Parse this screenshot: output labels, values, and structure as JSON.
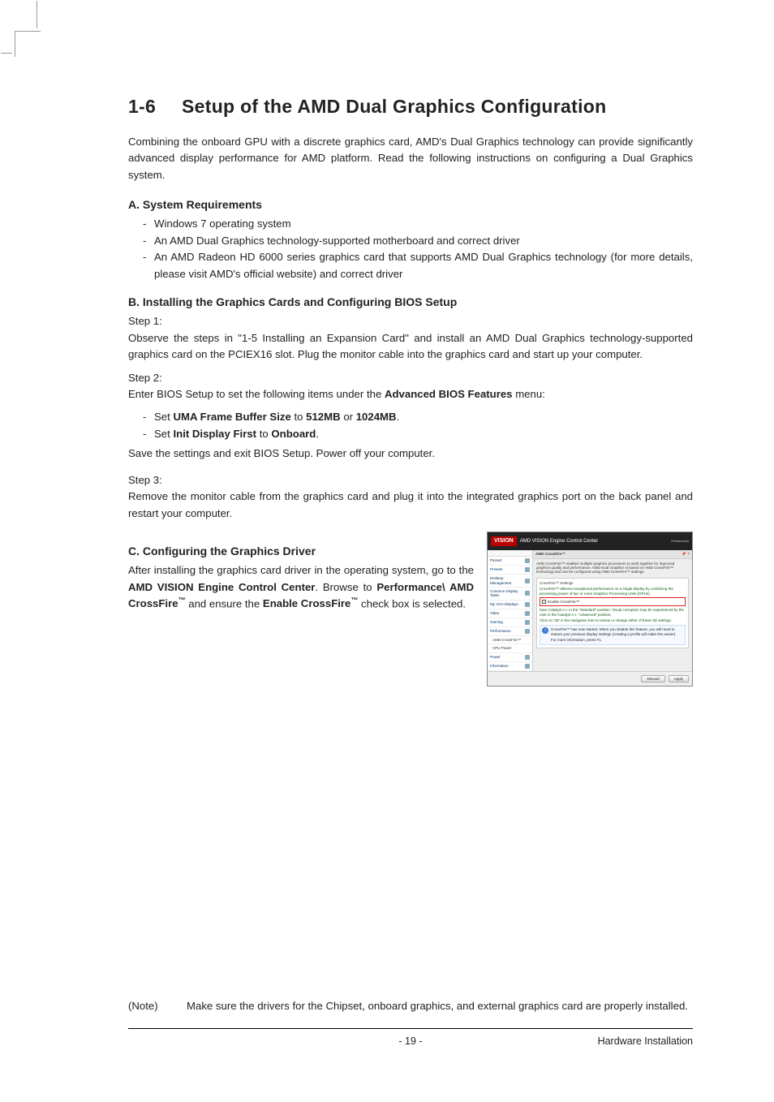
{
  "heading": {
    "number": "1-6",
    "title": "Setup of the AMD Dual Graphics Configuration"
  },
  "intro": "Combining the onboard GPU with a discrete graphics card, AMD's Dual Graphics technology can provide significantly advanced display performance for AMD platform. Read the following instructions on configuring a Dual Graphics system.",
  "sectionA": {
    "title": "A. System Requirements",
    "items": [
      "Windows 7 operating system",
      "An AMD Dual Graphics technology-supported motherboard and correct driver",
      "An AMD Radeon HD 6000 series graphics card that supports AMD Dual Graphics technology (for more details, please visit AMD's official website) and correct driver"
    ]
  },
  "sectionB": {
    "title": "B. Installing the Graphics Cards and Configuring BIOS Setup",
    "step1_label": "Step 1:",
    "step1_text": "Observe the steps in \"1-5 Installing an Expansion Card\" and install an AMD Dual Graphics technology-supported graphics card on the PCIEX16 slot. Plug the monitor cable into the graphics card and start up your computer.",
    "step2_label": "Step 2:",
    "step2_intro_pre": "Enter BIOS Setup to set the following items under the ",
    "step2_menu": "Advanced BIOS Features",
    "step2_intro_post": " menu:",
    "step2_items": {
      "a_pre": "Set ",
      "a_b1": "UMA Frame Buffer Size",
      "a_mid": " to ",
      "a_b2": "512MB",
      "a_or": " or ",
      "a_b3": "1024MB",
      "a_end": ".",
      "b_pre": "Set ",
      "b_b1": "Init Display First",
      "b_mid": " to ",
      "b_b2": "Onboard",
      "b_end": "."
    },
    "step2_save": "Save the settings and exit BIOS Setup. Power off your computer.",
    "step3_label": "Step 3:",
    "step3_text": "Remove the monitor cable from the graphics card and plug it into the integrated graphics port on the back panel and restart your computer."
  },
  "sectionC": {
    "title": "C. Configuring the Graphics Driver",
    "p_pre": "After installing the graphics card driver in the operating system, go to the ",
    "p_b1": "AMD VISION Engine Control Center",
    "p_mid1": ". Browse to ",
    "p_b2": "Performance\\ AMD CrossFire",
    "p_mid2": " and ensure the ",
    "p_b3": "Enable CrossFire",
    "p_post": " check box is selected."
  },
  "screenshot": {
    "logo": "VISION",
    "title": "AMD VISION Engine Control Center",
    "preferences": "Preferences",
    "crumb": "AMD CrossFire™",
    "pin": "📌  ?",
    "sidebar": [
      "Pinned",
      "Presets",
      "Desktop Management",
      "Common Display Tasks",
      "My VGA Displays",
      "Video",
      "Gaming",
      "Performance",
      "AMD CrossFire™",
      "CPU Power",
      "Power",
      "Information"
    ],
    "desc": "AMD CrossFire™ enables multiple graphics processors to work together for improved graphics quality and performance. AMD Dual Graphics is based on AMD CrossFire™ technology and can be configured using AMD CrossFire™ settings.",
    "panel_title": "CrossFire™ Settings",
    "panel_sub": "CrossFire™ delivers exceptional performance on a single display by combining the processing power of two or more Graphics Processing Units (GPUs).",
    "checkbox_label": "Enable CrossFire™",
    "green1": "have Catalyst A.I. in the \"Standard\" position. Visual corruption may be experienced by the user in the Catalyst A.I. \"Advanced\" position.",
    "green2": "Click on '3D' in the navigation tree to review or change either of these 3D settings.",
    "info_text": "CrossFire™ has now started. When you disable this feature, you will need to restore your previous display settings (creating a profile will make this easier).",
    "info_more": "For more information, press F1.",
    "btn_discard": "Discard",
    "btn_apply": "Apply"
  },
  "note": {
    "label": "(Note)",
    "text": "Make sure the drivers for the Chipset, onboard graphics, and external graphics card are properly installed."
  },
  "footer": {
    "page": "- 19 -",
    "section": "Hardware Installation"
  },
  "tm": "™"
}
